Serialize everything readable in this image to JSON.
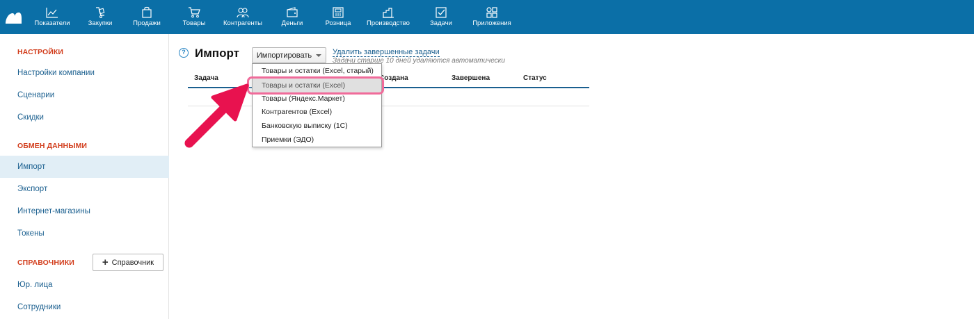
{
  "nav": {
    "items": [
      {
        "key": "indicators",
        "label": "Показатели",
        "icon": "chart-icon"
      },
      {
        "key": "purchases",
        "label": "Закупки",
        "icon": "cart-dolly-icon"
      },
      {
        "key": "sales",
        "label": "Продажи",
        "icon": "bag-icon"
      },
      {
        "key": "goods",
        "label": "Товары",
        "icon": "cart-icon"
      },
      {
        "key": "counterparties",
        "label": "Контрагенты",
        "icon": "users-icon"
      },
      {
        "key": "money",
        "label": "Деньги",
        "icon": "wallet-icon"
      },
      {
        "key": "retail",
        "label": "Розница",
        "icon": "register-icon"
      },
      {
        "key": "production",
        "label": "Производство",
        "icon": "factory-icon"
      },
      {
        "key": "tasks",
        "label": "Задачи",
        "icon": "checkbox-icon"
      },
      {
        "key": "apps",
        "label": "Приложения",
        "icon": "apps-icon"
      }
    ]
  },
  "sidebar": {
    "sections": {
      "settings": "НАСТРОЙКИ",
      "exchange": "ОБМЕН ДАННЫМИ",
      "references": "СПРАВОЧНИКИ"
    },
    "settings_items": [
      "Настройки компании",
      "Сценарии",
      "Скидки"
    ],
    "exchange_items": [
      "Импорт",
      "Экспорт",
      "Интернет-магазины",
      "Токены"
    ],
    "reference_items": [
      "Юр. лица",
      "Сотрудники"
    ],
    "add_reference_button": "Справочник",
    "active_item": "Импорт"
  },
  "main": {
    "help_icon_glyph": "?",
    "title": "Импорт",
    "import_button": "Импортировать",
    "delete_link": "Удалить завершенные задачи",
    "hint": "Задачи старше 10 дней удаляются автоматически",
    "columns": [
      "Задача",
      "Создана",
      "Завершена",
      "Статус"
    ]
  },
  "dropdown": {
    "items": [
      "Товары и остатки (Excel, старый)",
      "Товары и остатки (Excel)",
      "Товары (Яндекс.Маркет)",
      "Контрагентов (Excel)",
      "Банковскую выписку (1С)",
      "Приемки (ЭДО)"
    ],
    "highlighted_index": 1
  },
  "colors": {
    "topbar": "#0b6fa7",
    "section_heading": "#d23d1c",
    "link": "#1a5f8f",
    "highlight_ring": "#f06b9a",
    "arrow": "#e8124f"
  }
}
